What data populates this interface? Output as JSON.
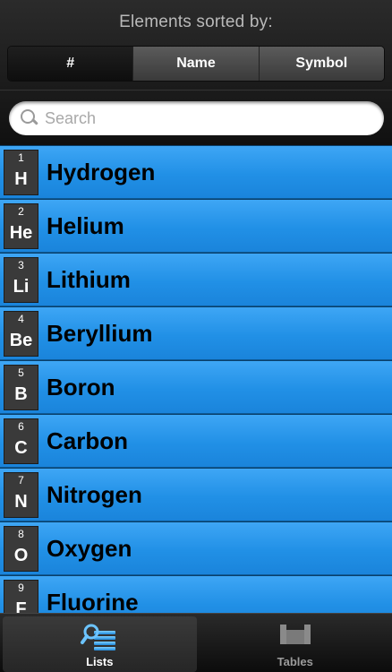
{
  "header": {
    "title": "Elements sorted by:",
    "sort_options": [
      {
        "label": "#",
        "selected": true
      },
      {
        "label": "Name",
        "selected": false
      },
      {
        "label": "Symbol",
        "selected": false
      }
    ]
  },
  "search": {
    "placeholder": "Search",
    "value": ""
  },
  "elements": [
    {
      "number": "1",
      "symbol": "H",
      "name": "Hydrogen"
    },
    {
      "number": "2",
      "symbol": "He",
      "name": "Helium"
    },
    {
      "number": "3",
      "symbol": "Li",
      "name": "Lithium"
    },
    {
      "number": "4",
      "symbol": "Be",
      "name": "Beryllium"
    },
    {
      "number": "5",
      "symbol": "B",
      "name": "Boron"
    },
    {
      "number": "6",
      "symbol": "C",
      "name": "Carbon"
    },
    {
      "number": "7",
      "symbol": "N",
      "name": "Nitrogen"
    },
    {
      "number": "8",
      "symbol": "O",
      "name": "Oxygen"
    },
    {
      "number": "9",
      "symbol": "F",
      "name": "Fluorine"
    }
  ],
  "tabbar": {
    "tabs": [
      {
        "label": "Lists",
        "icon": "lists-icon",
        "selected": true
      },
      {
        "label": "Tables",
        "icon": "tables-icon",
        "selected": false
      }
    ]
  },
  "colors": {
    "row_blue": "#2190e6",
    "tile_gray": "#3a3a3a",
    "header_text": "#b9b9b9"
  }
}
